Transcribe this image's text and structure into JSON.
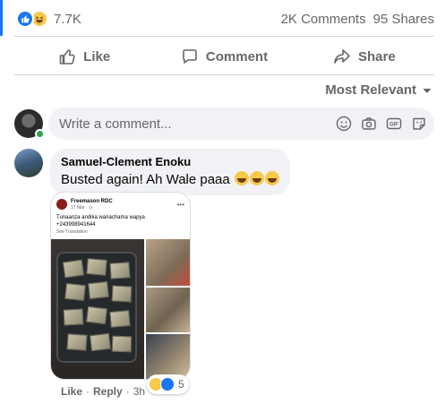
{
  "reactions": {
    "count": "7.7K",
    "types": [
      "like",
      "haha"
    ],
    "comments": "2K Comments",
    "shares": "95 Shares"
  },
  "actions": {
    "like": "Like",
    "comment": "Comment",
    "share": "Share"
  },
  "sort": {
    "label": "Most Relevant"
  },
  "composer": {
    "placeholder": "Write a comment...",
    "tools": [
      "emoji-icon",
      "camera-icon",
      "gif-icon",
      "sticker-icon"
    ]
  },
  "comment": {
    "author": "Samuel-Clement Enoku",
    "text": "Busted again! Ah Wale paaa",
    "emoji_count": 3,
    "attachment": {
      "inner_name": "Freemason RDC",
      "inner_time": "17 Mar · ⊙",
      "inner_text": "Tunaanza andika wanachama wapya",
      "inner_phone": "+243998941644",
      "inner_see": "See Translation"
    },
    "reaction_count": "5",
    "meta": {
      "like": "Like",
      "reply": "Reply",
      "time": "3h"
    }
  },
  "colors": {
    "brand": "#1877f2",
    "muted": "#65676b",
    "bubble": "#f0f2f5",
    "online": "#31a24c"
  }
}
